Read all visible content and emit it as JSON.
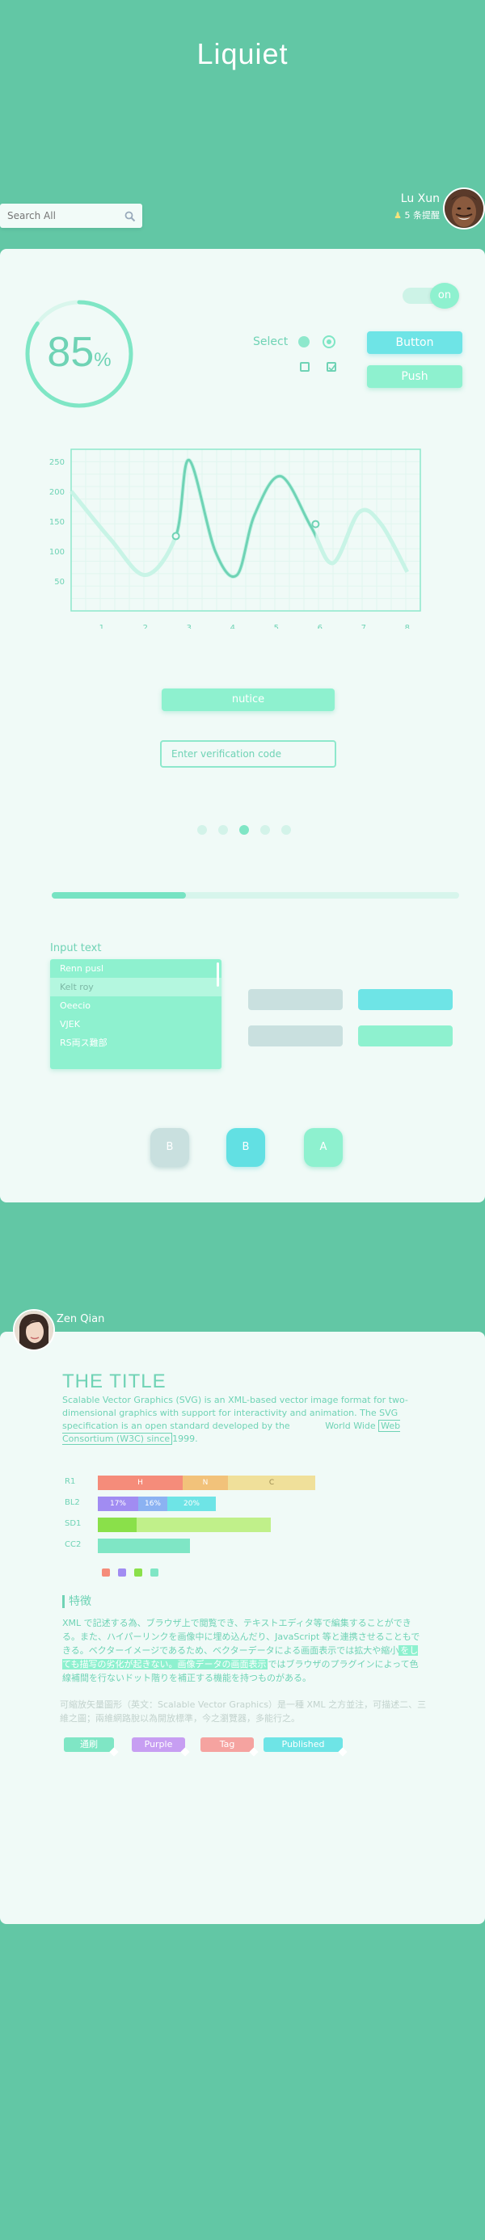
{
  "header": {
    "brand": "Liquiet"
  },
  "search": {
    "placeholder": "Search All"
  },
  "user1": {
    "name": "Lu Xun",
    "status": "5 条提醒"
  },
  "progress_ring": {
    "value": "85",
    "unit": "%",
    "fraction": 0.85
  },
  "controls": {
    "select_label": "Select",
    "toggle_label": "on",
    "button_label": "Button",
    "push_label": "Push"
  },
  "chart_data": {
    "type": "line",
    "x": [
      1,
      2,
      3,
      4,
      5,
      6,
      7,
      8
    ],
    "xticks": [
      "1",
      "2",
      "3",
      "4",
      "5",
      "6",
      "7",
      "8"
    ],
    "yticks": [
      "50",
      "100",
      "150",
      "200",
      "250"
    ],
    "ylim": [
      0,
      270
    ],
    "xlim": [
      0.3,
      8.3
    ],
    "grid": true,
    "series": [
      {
        "points": [
          [
            0.3,
            200
          ],
          [
            1.2,
            120
          ],
          [
            2,
            60
          ],
          [
            2.7,
            125
          ],
          [
            3,
            252
          ],
          [
            3.6,
            100
          ],
          [
            4.1,
            60
          ],
          [
            4.5,
            160
          ],
          [
            5.1,
            225
          ],
          [
            5.8,
            140
          ],
          [
            6.3,
            80
          ],
          [
            6.9,
            165
          ],
          [
            7.4,
            145
          ],
          [
            8,
            65
          ]
        ]
      }
    ],
    "markers": [
      [
        2.7,
        125
      ],
      [
        5.9,
        145
      ]
    ]
  },
  "form": {
    "notice_button": "nutice",
    "verify_placeholder": "Enter verification code"
  },
  "carousel": {
    "active_index": 2,
    "count": 5
  },
  "progress_bar": {
    "fraction": 0.33
  },
  "input_list": {
    "label": "Input text",
    "items": [
      "Renn pusl",
      "Kelt roy",
      "Oeecio",
      "VJEK",
      "RS両ス難部"
    ],
    "selected_index": 1
  },
  "square_buttons": [
    "B",
    "B",
    "A"
  ],
  "user2": {
    "name": "Zen Qian"
  },
  "article": {
    "title": "THE TITLE",
    "para_pre": "Scalable Vector Graphics (SVG) is an XML-based vector image format for two-dimensional graphics with support for interactivity and animation. The SVG specification is an open standard developed by the",
    "link_tail": "World Wide",
    "link_text": "Web Consortium   (W3C) since",
    "para_post": "1999."
  },
  "bar_rows": [
    {
      "label": "R1",
      "segments": [
        "H",
        "N",
        "C"
      ]
    },
    {
      "label": "BL2",
      "segments": [
        "17%",
        "16%",
        "20%"
      ]
    },
    {
      "label": "SD1",
      "segments": [
        "",
        ""
      ]
    },
    {
      "label": "CC2",
      "segments": [
        ""
      ]
    }
  ],
  "legend_colors": [
    "#f58c7a",
    "#a18cf2",
    "#8ae04a",
    "#7fe6c5"
  ],
  "features": {
    "title": "特徴",
    "text_1": "XML で記述する為、ブラウザ上で閲覧でき、テキストエディタ等で編集することができる。また、ハイパーリンクを画像中に埋め込んだり、JavaScript 等と連携させることもできる。ベクターイメージであるため、ベクターデータによる画面表示では拡大や縮小",
    "highlight": "をしても描写の劣化が起きない。画像データの画面表示",
    "text_2": "ではブラウザのプラグインによって色線補間を行ないドット階りを補正する機能を持つものがある。"
  },
  "gray_text": "可縮放矢量圖形（英文：Scalable Vector Graphics）是一種 XML 之方並注，可描述二、三維之圖；兩維網路脫以為開放標準，今之瀏覽器，多能行之。",
  "tags": [
    {
      "label": "通刷",
      "color": "#7fe6c5"
    },
    {
      "label": "Purple",
      "color": "#c79ef2"
    },
    {
      "label": "Tag",
      "color": "#f5a3a0"
    },
    {
      "label": "Published",
      "color": "#6ee4e6"
    }
  ]
}
